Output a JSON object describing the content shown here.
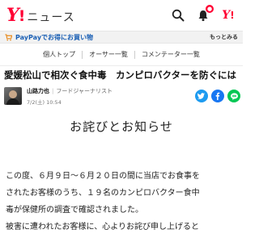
{
  "header": {
    "logo_y": "Y",
    "logo_bang": "!",
    "logo_news": "ニュース",
    "icons": [
      "search-icon",
      "bell-icon",
      "yahoo-top-icon"
    ],
    "brand_color": "#ff0033"
  },
  "promo": {
    "text": "PayPayでお得にお買い物",
    "more": "もっとみる",
    "icon": "paypay-cart-icon"
  },
  "nav": {
    "tabs": [
      "個人トップ",
      "オーサー一覧",
      "コメンテーター一覧"
    ]
  },
  "article": {
    "title": "愛媛松山で相次ぐ食中毒　カンピロバクターを防ぐには",
    "author": {
      "name": "山路力也",
      "role": "フードジャーナリスト",
      "date": "7/2(土) 10:54"
    },
    "share": [
      "twitter-icon",
      "facebook-icon",
      "line-icon"
    ]
  },
  "notice": {
    "heading": "お詫びとお知らせ",
    "lines": [
      "この度、６月９日～６月２０日の間に当店でお食事を",
      "されたお客様のうち、１９名のカンピロバクター食中",
      "毒が保健所の調査で確認されました。",
      "被害に遭われたお客様に、心よりお詫び申し上げると"
    ]
  }
}
